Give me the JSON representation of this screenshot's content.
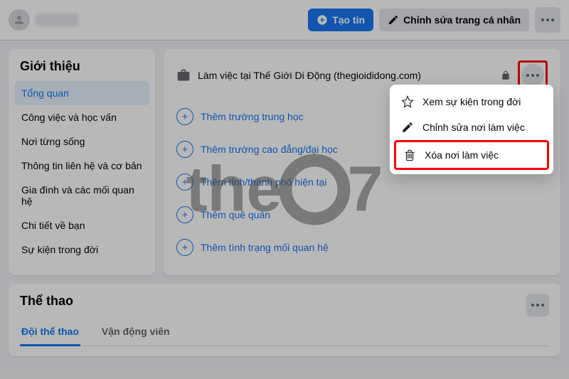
{
  "header": {
    "create_story": "Tạo tin",
    "edit_profile": "Chỉnh sửa trang cá nhân"
  },
  "sidebar": {
    "title": "Giới thiệu",
    "items": [
      "Tổng quan",
      "Công việc và học vấn",
      "Nơi từng sống",
      "Thông tin liên hệ và cơ bản",
      "Gia đình và các mối quan hệ",
      "Chi tiết về bạn",
      "Sự kiện trong đời"
    ]
  },
  "content": {
    "work_text": "Làm việc tại Thế Giới Di Động (thegioididong.com)",
    "add_items": [
      "Thêm trường trung học",
      "Thêm trường cao đẳng/đại học",
      "Thêm tỉnh/thành phố hiện tại",
      "Thêm quê quán",
      "Thêm tình trạng mối quan hệ"
    ]
  },
  "dropdown": {
    "view_life_event": "Xem sự kiện trong đời",
    "edit_workplace": "Chỉnh sửa nơi làm việc",
    "delete_workplace": "Xóa nơi làm việc"
  },
  "sports": {
    "title": "Thể thao",
    "tab_teams": "Đội thể thao",
    "tab_athletes": "Vận động viên"
  },
  "watermark": {
    "pre": "the",
    "post": "7"
  }
}
